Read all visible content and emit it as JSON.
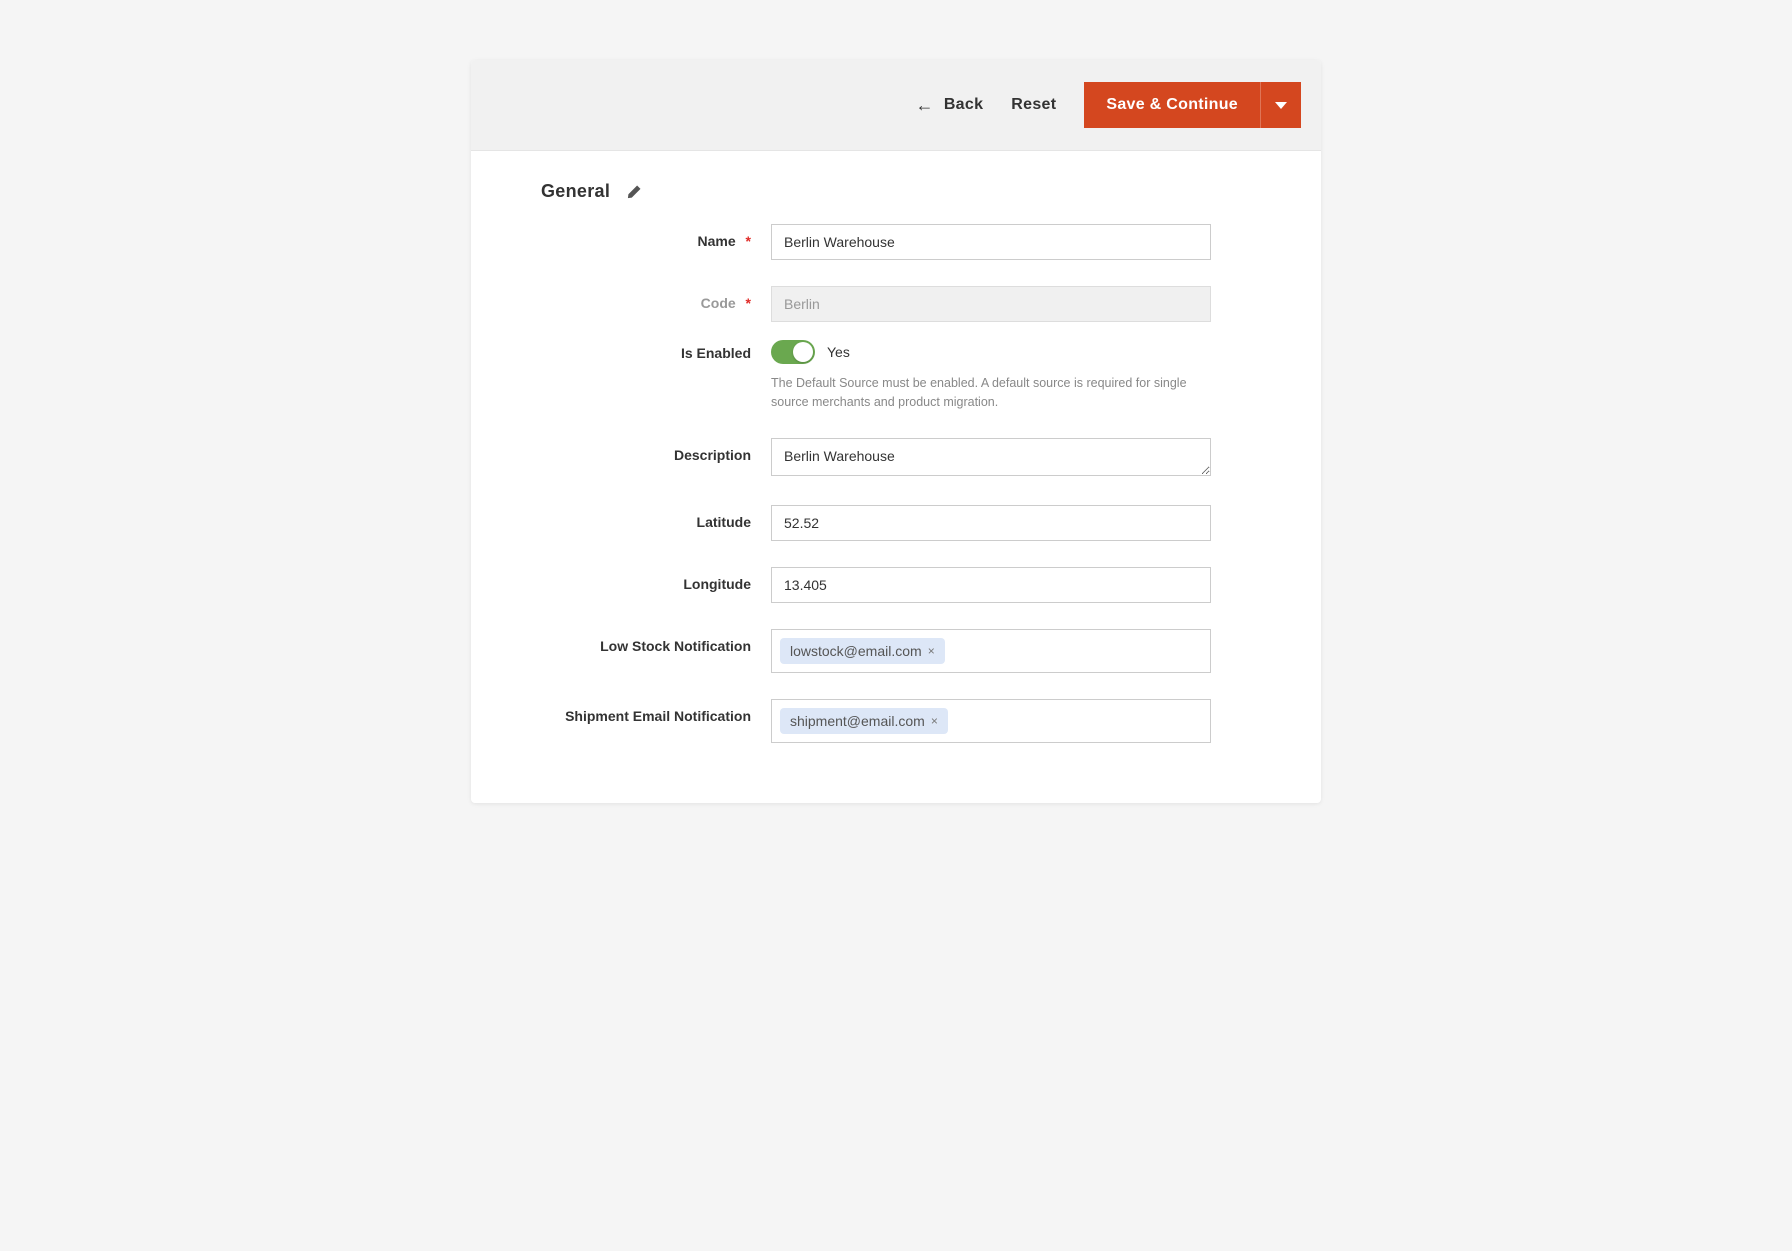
{
  "toolbar": {
    "back_label": "Back",
    "reset_label": "Reset",
    "save_label": "Save & Continue"
  },
  "section": {
    "title": "General"
  },
  "fields": {
    "name": {
      "label": "Name",
      "value": "Berlin Warehouse"
    },
    "code": {
      "label": "Code",
      "value": "Berlin"
    },
    "is_enabled": {
      "label": "Is Enabled",
      "value_label": "Yes",
      "help": "The Default Source must be enabled. A default source is required for single source merchants and product migration."
    },
    "description": {
      "label": "Description",
      "value": "Berlin Warehouse"
    },
    "latitude": {
      "label": "Latitude",
      "value": "52.52"
    },
    "longitude": {
      "label": "Longitude",
      "value": "13.405"
    },
    "low_stock": {
      "label": "Low Stock Notification",
      "tag": "lowstock@email.com"
    },
    "shipment_email": {
      "label": "Shipment Email Notification",
      "tag": "shipment@email.com"
    }
  }
}
